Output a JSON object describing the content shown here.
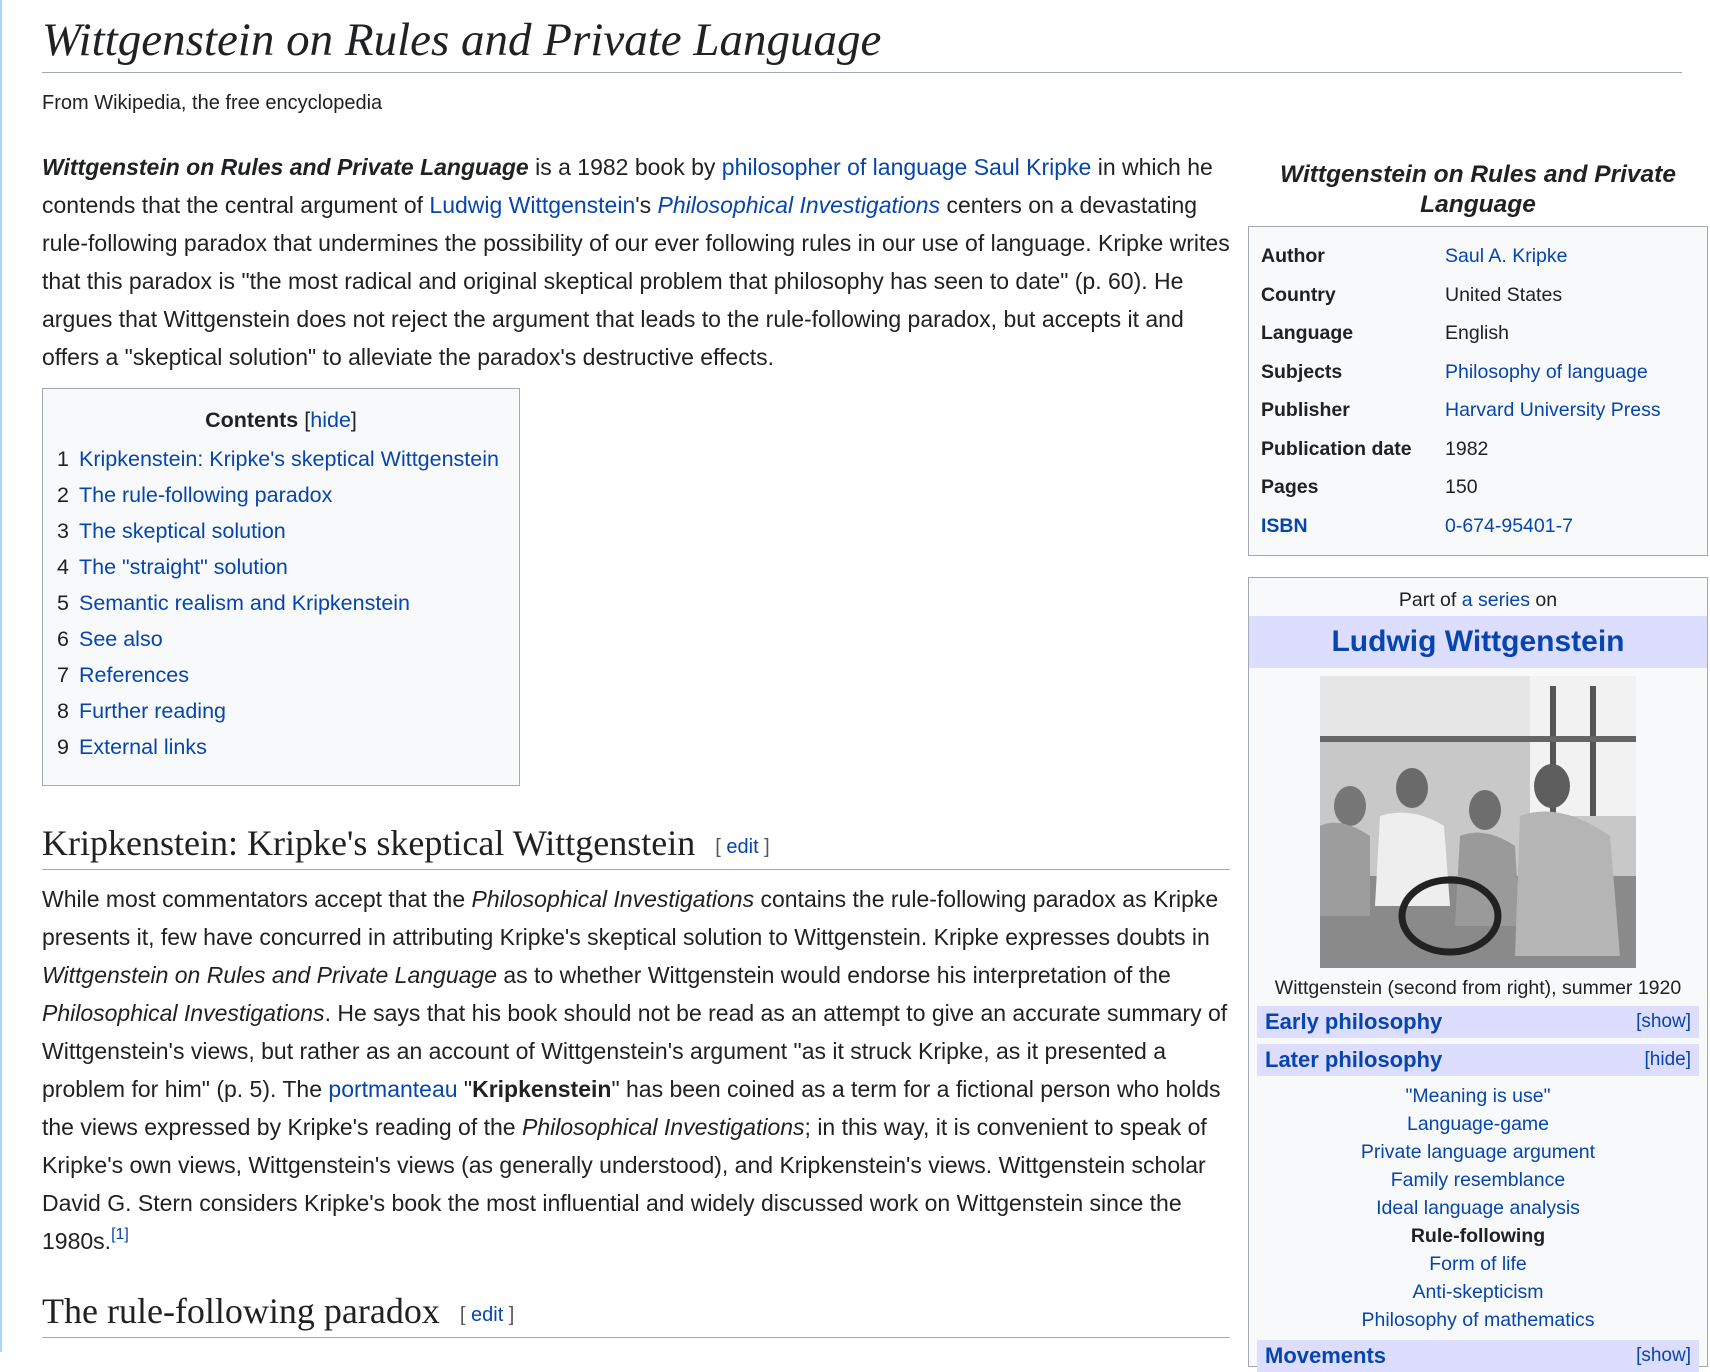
{
  "article": {
    "title": "Wittgenstein on Rules and Private Language",
    "tagline": "From Wikipedia, the free encyclopedia"
  },
  "lead": {
    "bold_title": "Wittgenstein on Rules and Private Language",
    "t1": " is a 1982 book by ",
    "link_philosopher": "philosopher of language",
    "space1": " ",
    "link_kripke": "Saul Kripke",
    "t2": " in which he contends that the central argument of ",
    "link_wittgenstein": "Ludwig Wittgenstein",
    "t3": "'s ",
    "link_pi": "Philosophical Investigations",
    "t4": " centers on a devastating rule-following paradox that undermines the possibility of our ever following rules in our use of language. Kripke writes that this paradox is \"the most radical and original skeptical problem that philosophy has seen to date\" (p. 60). He argues that Wittgenstein does not reject the argument that leads to the rule-following paradox, but accepts it and offers a \"skeptical solution\" to alleviate the paradox's destructive effects."
  },
  "toc": {
    "title": "Contents",
    "toggle_open": "[",
    "toggle": "hide",
    "toggle_close": "]",
    "items": [
      {
        "num": "1",
        "label": "Kripkenstein: Kripke's skeptical Wittgenstein"
      },
      {
        "num": "2",
        "label": "The rule-following paradox"
      },
      {
        "num": "3",
        "label": "The skeptical solution"
      },
      {
        "num": "4",
        "label": "The \"straight\" solution"
      },
      {
        "num": "5",
        "label": "Semantic realism and Kripkenstein"
      },
      {
        "num": "6",
        "label": "See also"
      },
      {
        "num": "7",
        "label": "References"
      },
      {
        "num": "8",
        "label": "Further reading"
      },
      {
        "num": "9",
        "label": "External links"
      }
    ]
  },
  "section1": {
    "heading": "Kripkenstein: Kripke's skeptical Wittgenstein",
    "edit_open": "[ ",
    "edit": "edit",
    "edit_close": " ]",
    "t1": "While most commentators accept that the ",
    "i1": "Philosophical Investigations",
    "t2": " contains the rule-following paradox as Kripke presents it, few have concurred in attributing Kripke's skeptical solution to Wittgenstein. Kripke expresses doubts in ",
    "i2": "Wittgenstein on Rules and Private Language",
    "t3": " as to whether Wittgenstein would endorse his interpretation of the ",
    "i3": "Philosophical Investigations",
    "t4": ". He says that his book should not be read as an attempt to give an accurate summary of Wittgenstein's views, but rather as an account of Wittgenstein's argument \"as it struck Kripke, as it presented a problem for him\" (p. 5). The ",
    "link_portmanteau": "portmanteau",
    "t5": " \"",
    "b1": "Kripkenstein",
    "t6": "\" has been coined as a term for a fictional person who holds the views expressed by Kripke's reading of the ",
    "i4": "Philosophical Investigations",
    "t7": "; in this way, it is convenient to speak of Kripke's own views, Wittgenstein's views (as generally understood), and Kripkenstein's views. Wittgenstein scholar David G. Stern considers Kripke's book the most influential and widely discussed work on Wittgenstein since the 1980s.",
    "ref": "[1]"
  },
  "section2": {
    "heading": "The rule-following paradox",
    "edit_open": "[ ",
    "edit": "edit",
    "edit_close": " ]"
  },
  "infobox": {
    "caption": "Wittgenstein on Rules and Private Language",
    "rows": [
      {
        "label": "Author",
        "value": "Saul A. Kripke",
        "link": true
      },
      {
        "label": "Country",
        "value": "United States",
        "link": false
      },
      {
        "label": "Language",
        "value": "English",
        "link": false
      },
      {
        "label": "Subjects",
        "value": "Philosophy of language",
        "link": true
      },
      {
        "label": "Publisher",
        "value": "Harvard University Press",
        "link": true
      },
      {
        "label": "Publication date",
        "value": "1982",
        "link": false
      },
      {
        "label": "Pages",
        "value": "150",
        "link": false
      },
      {
        "label": "ISBN",
        "value": "0-674-95401-7",
        "link": true
      }
    ]
  },
  "series": {
    "above_t1": "Part of ",
    "above_link": "a series",
    "above_t2": " on",
    "title": "Ludwig Wittgenstein",
    "photo_caption": "Wittgenstein (second from right), summer 1920",
    "group_early": "Early philosophy",
    "toggle_show": "[show]",
    "group_later": "Later philosophy",
    "toggle_hide": "[hide]",
    "later_items": [
      "\"Meaning is use\"",
      "Language-game",
      "Private language argument",
      "Family resemblance",
      "Ideal language analysis",
      "Rule-following",
      "Form of life",
      "Anti-skepticism",
      "Philosophy of mathematics"
    ],
    "group_movements": "Movements"
  },
  "colors": {
    "link": "#0645ad",
    "text": "#202122",
    "border": "#a2a9b1",
    "panel": "#f8f9fa",
    "series_header": "#ddddff"
  }
}
